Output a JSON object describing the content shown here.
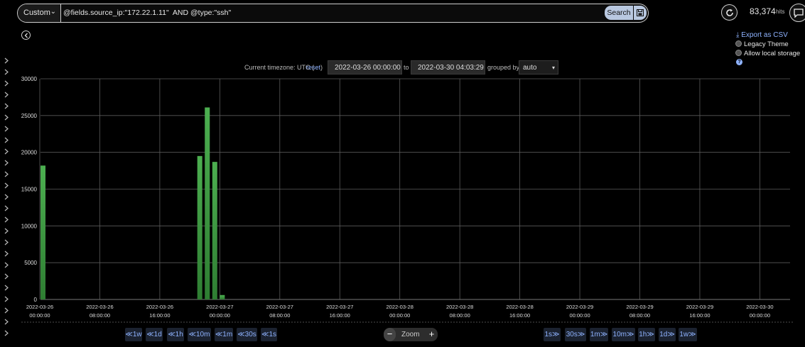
{
  "search": {
    "range_label": "Custom",
    "query": "@fields.source_ip:\"172.22.1.11\"  AND @type:\"ssh\"",
    "search_label": "Search"
  },
  "header": {
    "hits_count": "83,374",
    "hits_unit": "hits"
  },
  "options": {
    "export_csv": "Export as CSV",
    "legacy_theme": "Legacy Theme",
    "allow_local_storage": "Allow local storage",
    "help": "?"
  },
  "timezone": {
    "label": "Current timezone: UTC (",
    "reset": "reset",
    "reset_close": ")",
    "from": "2022-03-26 00:00:00",
    "to_label": "to",
    "to": "2022-03-30 04:03:29",
    "grouped_by_label": "grouped by",
    "group_value": "auto"
  },
  "colors": {
    "bar": "#4caf50",
    "bar_dark": "#2e7d32",
    "grid": "#5a5a5a",
    "link": "#8fb3ff"
  },
  "nav": {
    "back": [
      "≪1w",
      "≪1d",
      "≪1h",
      "≪10m",
      "≪1m",
      "≪30s",
      "≪1s"
    ],
    "zoom_minus": "−",
    "zoom_label": "Zoom",
    "zoom_plus": "+",
    "forward": [
      "1s≫",
      "30s≫",
      "1m≫",
      "10m≫",
      "1h≫",
      "1d≫",
      "1w≫"
    ]
  },
  "chart_data": {
    "type": "bar",
    "ylim": [
      0,
      30000
    ],
    "y_ticks": [
      "0",
      "5000",
      "10000",
      "15000",
      "20000",
      "25000",
      "30000"
    ],
    "x_ticks": [
      {
        "date": "2022-03-26",
        "time": "00:00:00"
      },
      {
        "date": "2022-03-26",
        "time": "08:00:00"
      },
      {
        "date": "2022-03-26",
        "time": "16:00:00"
      },
      {
        "date": "2022-03-27",
        "time": "00:00:00"
      },
      {
        "date": "2022-03-27",
        "time": "08:00:00"
      },
      {
        "date": "2022-03-27",
        "time": "16:00:00"
      },
      {
        "date": "2022-03-28",
        "time": "00:00:00"
      },
      {
        "date": "2022-03-28",
        "time": "08:00:00"
      },
      {
        "date": "2022-03-28",
        "time": "16:00:00"
      },
      {
        "date": "2022-03-29",
        "time": "00:00:00"
      },
      {
        "date": "2022-03-29",
        "time": "08:00:00"
      },
      {
        "date": "2022-03-29",
        "time": "16:00:00"
      },
      {
        "date": "2022-03-30",
        "time": "00:00:00"
      }
    ],
    "bars": [
      {
        "x": "2022-03-26 00:00",
        "value": 18200
      },
      {
        "x": "2022-03-26 21:00",
        "value": 19500
      },
      {
        "x": "2022-03-26 22:00",
        "value": 26100
      },
      {
        "x": "2022-03-26 23:00",
        "value": 18700
      },
      {
        "x": "2022-03-27 00:00",
        "value": 600
      }
    ]
  }
}
